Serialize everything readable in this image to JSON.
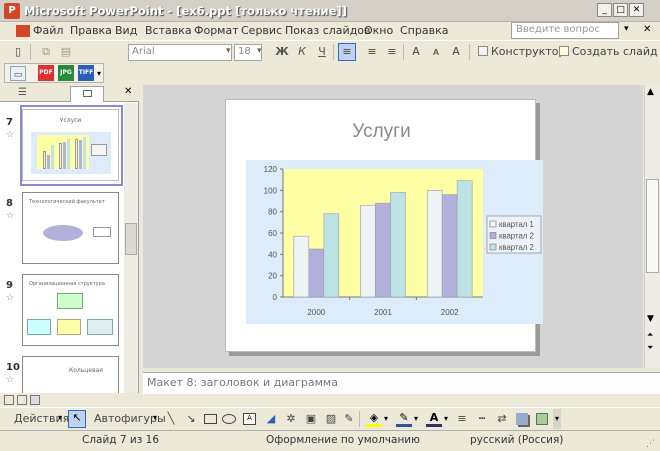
{
  "window": {
    "title": "Microsoft PowerPoint - [ex6.ppt [только чтение]]",
    "app_icon": "P"
  },
  "menu": {
    "items": [
      "Файл",
      "Правка",
      "Вид",
      "Вставка",
      "Формат",
      "Сервис",
      "Показ слайдов",
      "Окно",
      "Справка"
    ],
    "help_placeholder": "Введите вопрос"
  },
  "format_toolbar": {
    "font": "Arial",
    "size": "18",
    "bold": "Ж",
    "italic": "К",
    "underline": "Ч",
    "designer_label": "Конструктор",
    "new_slide_label": "Создать слайд"
  },
  "export_toolbar": {
    "items": [
      "PDF",
      "JPG",
      "TIFF"
    ]
  },
  "thumbnails": [
    {
      "num": "7",
      "title": "Услуги",
      "selected": true
    },
    {
      "num": "8",
      "title": "Технологический факультет",
      "selected": false
    },
    {
      "num": "9",
      "title": "Организационная структура",
      "selected": false
    },
    {
      "num": "10",
      "title": "Кольцевая",
      "selected": false
    }
  ],
  "slide": {
    "title": "Услуги"
  },
  "chart_data": {
    "type": "bar",
    "categories": [
      "2000",
      "2001",
      "2002"
    ],
    "series": [
      {
        "name": "квартал 1",
        "values": [
          57,
          86,
          100
        ],
        "color": "#eef4f4"
      },
      {
        "name": "квартал 2",
        "values": [
          45,
          88,
          96
        ],
        "color": "#b3b0dc"
      },
      {
        "name": "квартал 3",
        "values": [
          78,
          98,
          109
        ],
        "color": "#bde4e4"
      }
    ],
    "legend_labels": [
      "квартал 1",
      "квартал 2",
      "квартал 2"
    ],
    "yticks": [
      "0",
      "20",
      "40",
      "60",
      "80",
      "100",
      "120"
    ],
    "ylim": [
      0,
      120
    ],
    "legend": "right",
    "plot_bg": "#ffffa6",
    "chart_bg": "#dcecfa"
  },
  "notes": {
    "placeholder": "Макет 8: заголовок и диаграмма"
  },
  "draw_toolbar": {
    "actions_label": "Действия",
    "autoshapes_label": "Автофигуры"
  },
  "status": {
    "slide": "Слайд 7 из 16",
    "design": "Оформление по умолчанию",
    "language": "русский (Россия)"
  }
}
